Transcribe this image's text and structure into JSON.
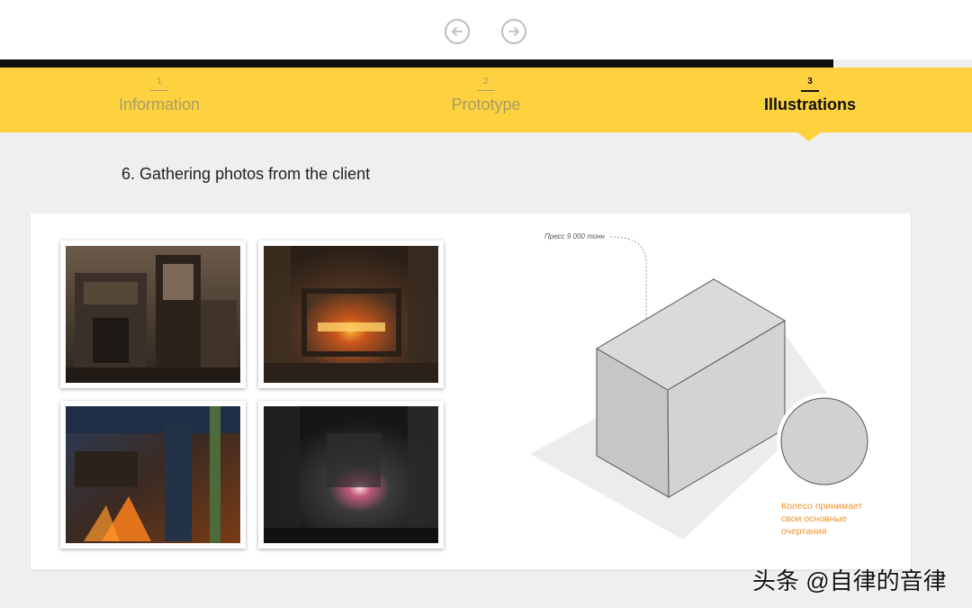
{
  "nav": {
    "prev_icon": "arrow-left-icon",
    "next_icon": "arrow-right-icon"
  },
  "steps": [
    {
      "number": "1",
      "label": "Information",
      "active": false
    },
    {
      "number": "2",
      "label": "Prototype",
      "active": false
    },
    {
      "number": "3",
      "label": "Illustrations",
      "active": true
    }
  ],
  "section": {
    "title": "6. Gathering photos from the client"
  },
  "photos": [
    {
      "name": "factory-press-photo",
      "tone": "brown"
    },
    {
      "name": "forge-furnace-photo",
      "tone": "orange"
    },
    {
      "name": "molten-metal-photo",
      "tone": "blue-orange"
    },
    {
      "name": "dark-furnace-photo",
      "tone": "grey"
    }
  ],
  "illustration": {
    "callout_label": "Пресс 9 000 тонн",
    "wheel_caption_lines": [
      "Колесо принимает",
      "свои основные",
      "очертания"
    ],
    "accent_color": "#f0922b"
  },
  "colors": {
    "yellow": "#fdd23e",
    "black_bar": "#0d0d0d",
    "background": "#efefef"
  },
  "watermark": {
    "text": "头条 @自律的音律"
  }
}
